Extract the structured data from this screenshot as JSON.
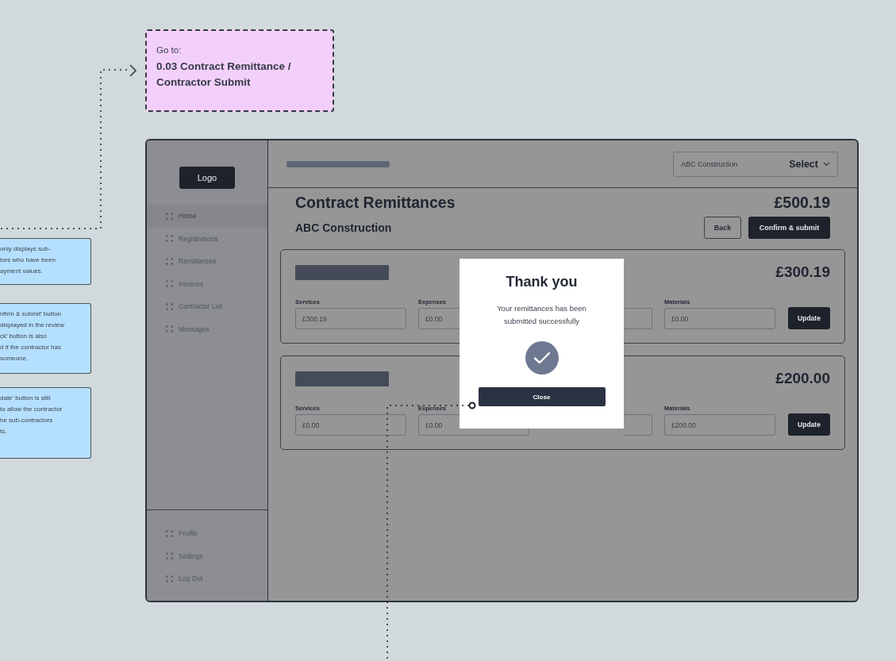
{
  "goto_note": {
    "label": "Go to:",
    "target": "0.03 Contract Remittance / Contractor Submit"
  },
  "notes": [
    {
      "text": "only displays sub-\ntors who have been\nayment values."
    },
    {
      "text": "nfirm & submit’ button\ndisplayed in the review\nck’ button is also\nd if the contractor has\nsomeone."
    },
    {
      "text": "date’ button is still\nto allow the contractor\nhe sub-contractors\nts."
    }
  ],
  "app": {
    "sidebar": {
      "logo": "Logo",
      "items": [
        {
          "label": "Home",
          "selected": true
        },
        {
          "label": "Registrations",
          "selected": false
        },
        {
          "label": "Remittances",
          "selected": false
        },
        {
          "label": "Invoices",
          "selected": false
        },
        {
          "label": "Contractor List",
          "selected": false
        },
        {
          "label": "Messages",
          "selected": false
        }
      ],
      "footer_items": [
        {
          "label": "Profile"
        },
        {
          "label": "Settings"
        },
        {
          "label": "Log Out"
        }
      ]
    },
    "header": {
      "company_select": {
        "value": "ABC Construction",
        "label": "Select"
      }
    },
    "page": {
      "title": "Contract Remittances",
      "total": "£500.19",
      "company": "ABC Construction",
      "buttons": [
        {
          "label": "Back",
          "kind": "outline"
        },
        {
          "label": "Confirm & submit",
          "kind": "primary"
        }
      ]
    },
    "cards": [
      {
        "amount": "£300.19",
        "button": "Update",
        "fields": [
          {
            "kind": "input",
            "label": "Services",
            "value": "£300.19"
          },
          {
            "kind": "input",
            "label": "Expenses",
            "value": "£0.00"
          },
          {
            "kind": "covered"
          },
          {
            "kind": "input",
            "label": "Materials",
            "value": "£0.00"
          }
        ]
      },
      {
        "amount": "£200.00",
        "button": "Update",
        "fields": [
          {
            "kind": "input",
            "label": "Services",
            "value": "£0.00"
          },
          {
            "kind": "input",
            "label": "Expenses",
            "value": "£0.00"
          },
          {
            "kind": "covered"
          },
          {
            "kind": "input",
            "label": "Materials",
            "value": "£200.00"
          }
        ]
      }
    ]
  },
  "modal": {
    "title": "Thank you",
    "message": "Your remittances has been submitted successfully",
    "button": "Close"
  }
}
